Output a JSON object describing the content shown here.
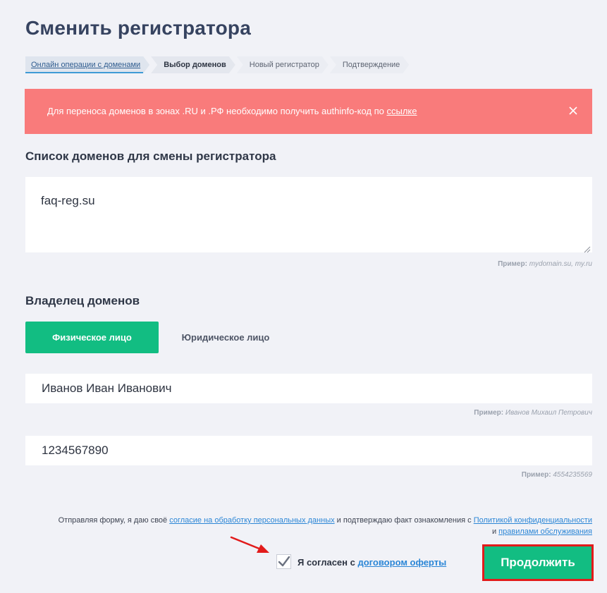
{
  "page": {
    "title": "Сменить регистратора"
  },
  "breadcrumb": {
    "items": [
      {
        "label": "Онлайн операции с доменами"
      },
      {
        "label": "Выбор доменов"
      },
      {
        "label": "Новый регистратор"
      },
      {
        "label": "Подтверждение"
      }
    ]
  },
  "alert": {
    "text": "Для переноса доменов в зонах .RU и .РФ необходимо получить authinfo-код по ",
    "link": "ссылке",
    "background": "#f97b7b"
  },
  "domains": {
    "title": "Список доменов для смены регистратора",
    "value": "faq-reg.su",
    "hint_label": "Пример:",
    "hint_value": "mydomain.su, my.ru"
  },
  "owner": {
    "title": "Владелец доменов",
    "tabs": [
      {
        "label": "Физическое лицо",
        "active": true
      },
      {
        "label": "Юридическое лицо",
        "active": false
      }
    ],
    "name": {
      "value": "Иванов Иван Иванович",
      "hint_label": "Пример:",
      "hint_value": "Иванов Михаил Петрович"
    },
    "inn": {
      "value": "1234567890",
      "hint_label": "Пример:",
      "hint_value": "4554235569"
    }
  },
  "consent": {
    "part1": "Отправляя форму, я даю своё ",
    "link1": "согласие на обработку персональных данных",
    "part2": " и подтверждаю факт ознакомления с ",
    "link2": "Политикой конфиденциальности",
    "part3": "и ",
    "link3": "правилами обслуживания"
  },
  "agreement": {
    "label": "Я согласен с ",
    "link": "договором оферты",
    "checked": true
  },
  "submit": {
    "label": "Продолжить",
    "color": "#12bd82",
    "highlight": "#e21b1b"
  },
  "colors": {
    "accent": "#12bd82",
    "link": "#2b86d6",
    "background": "#f1f2f7"
  }
}
